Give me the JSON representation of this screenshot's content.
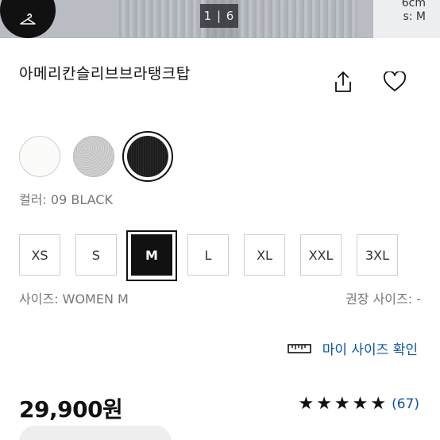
{
  "hero": {
    "counter": "1 | 6",
    "side_text_1": "6cm",
    "side_text_2": "s: M",
    "icon": "hanger-icon"
  },
  "product": {
    "title": "아메리칸슬리브브라탱크탑",
    "share_icon": "share-icon",
    "wish_icon": "heart-icon"
  },
  "colors": {
    "swatches": [
      {
        "name": "white",
        "color": "#fbfbfa"
      },
      {
        "name": "grey",
        "color": "#cccccc"
      },
      {
        "name": "black",
        "color": "#1f1f1f",
        "selected": true
      }
    ],
    "label": "컬러: 09 BLACK"
  },
  "sizes": {
    "options": [
      "XS",
      "S",
      "M",
      "L",
      "XL",
      "XXL",
      "3XL"
    ],
    "selected": "M",
    "label": "사이즈: WOMEN M",
    "recommended_label": "권장 사이즈: -"
  },
  "my_size": {
    "label": "마이 사이즈 확인",
    "icon": "ruler-icon"
  },
  "price": "29,900원",
  "rating": {
    "stars": "★★★★★",
    "value": 5,
    "count": "(67)"
  },
  "accent_color": "#0b55a6"
}
